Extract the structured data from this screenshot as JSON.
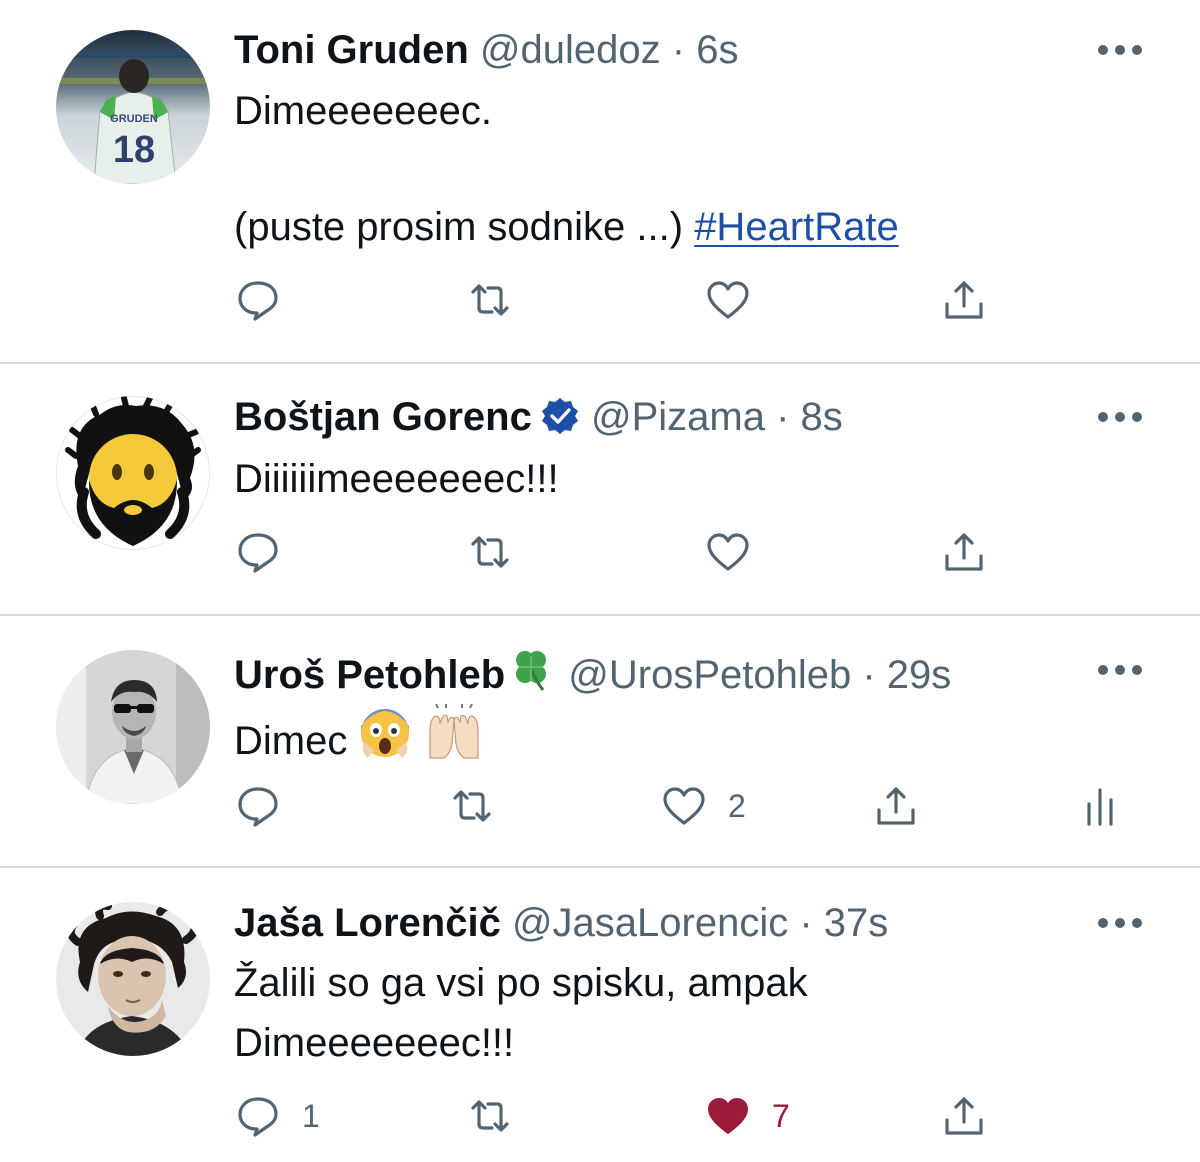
{
  "tweets": [
    {
      "name": "Toni Gruden",
      "handle": "@duledoz",
      "sep": " · ",
      "time": "6s",
      "lines": [
        "Dimeeeeeeec.",
        "",
        "(puste prosim sodnike ...) "
      ],
      "hashtag": "#HeartRate",
      "avatar_text": {
        "jersey_name": "GRUDEN",
        "jersey_number": "18"
      },
      "actions": {
        "reply_count": "",
        "retweet_count": "",
        "like_count": "",
        "liked": false
      }
    },
    {
      "name": "Boštjan Gorenc",
      "handle": "@Pizama",
      "sep": " · ",
      "time": "8s",
      "verified": true,
      "lines": [
        "Diiiiiimeeeeeeec!!!"
      ],
      "actions": {
        "reply_count": "",
        "retweet_count": "",
        "like_count": "",
        "liked": false
      }
    },
    {
      "name": "Uroš Petohleb",
      "name_emoji": "four-leaf-clover",
      "handle": "@UrosPetohleb",
      "sep": " · ",
      "time": "29s",
      "lines": [
        "Dimec "
      ],
      "text_emojis": [
        "face-screaming-in-fear",
        "raising-hands"
      ],
      "actions": {
        "reply_count": "",
        "retweet_count": "",
        "like_count": "2",
        "liked": false,
        "analytics": true
      }
    },
    {
      "name": "Jaša Lorenčič",
      "handle": "@JasaLorencic",
      "sep": " · ",
      "time": "37s",
      "lines": [
        "Žalili so ga vsi po spisku, ampak",
        "Dimeeeeeeec!!!"
      ],
      "actions": {
        "reply_count": "1",
        "retweet_count": "",
        "like_count": "7",
        "liked": true
      }
    }
  ],
  "colors": {
    "text": "#0f1419",
    "secondary": "#536471",
    "link": "#1d4ea8",
    "verified": "#1d4ea8",
    "liked": "#9b1c3a",
    "divider": "#d9d9d9"
  }
}
